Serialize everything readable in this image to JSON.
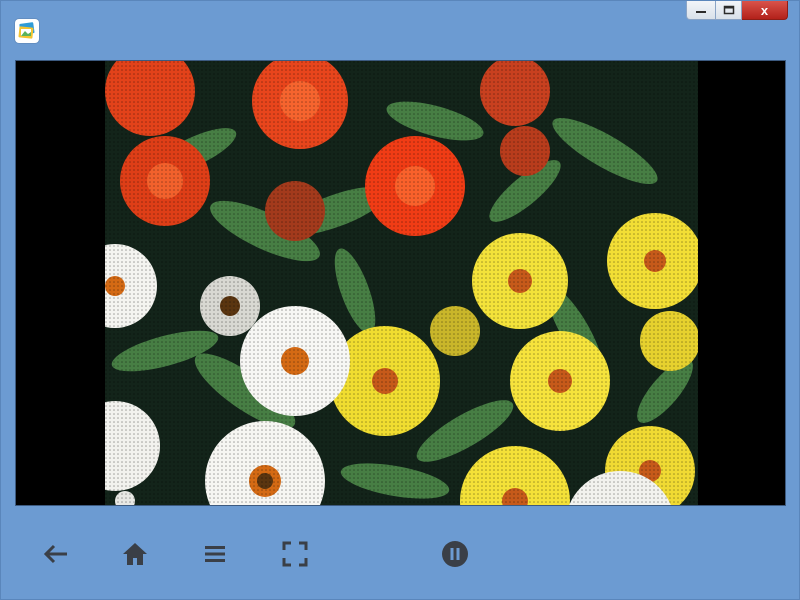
{
  "window": {
    "app_icon": "photo-viewer-icon",
    "controls": {
      "minimize_icon": "minimize-icon",
      "maximize_icon": "maximize-icon",
      "close_label": "x"
    }
  },
  "viewer": {
    "image_subject": "zinnia-flowers-photo"
  },
  "toolbar": {
    "buttons": [
      {
        "icon": "back-arrow-icon"
      },
      {
        "icon": "home-icon"
      },
      {
        "icon": "menu-icon"
      },
      {
        "icon": "fullscreen-icon"
      },
      {
        "icon": "pause-icon"
      }
    ]
  },
  "colors": {
    "window_bg": "#6c9bd2",
    "viewer_bg": "#000000",
    "icon_color": "#3a3f47",
    "close_red": "#c0392b"
  }
}
